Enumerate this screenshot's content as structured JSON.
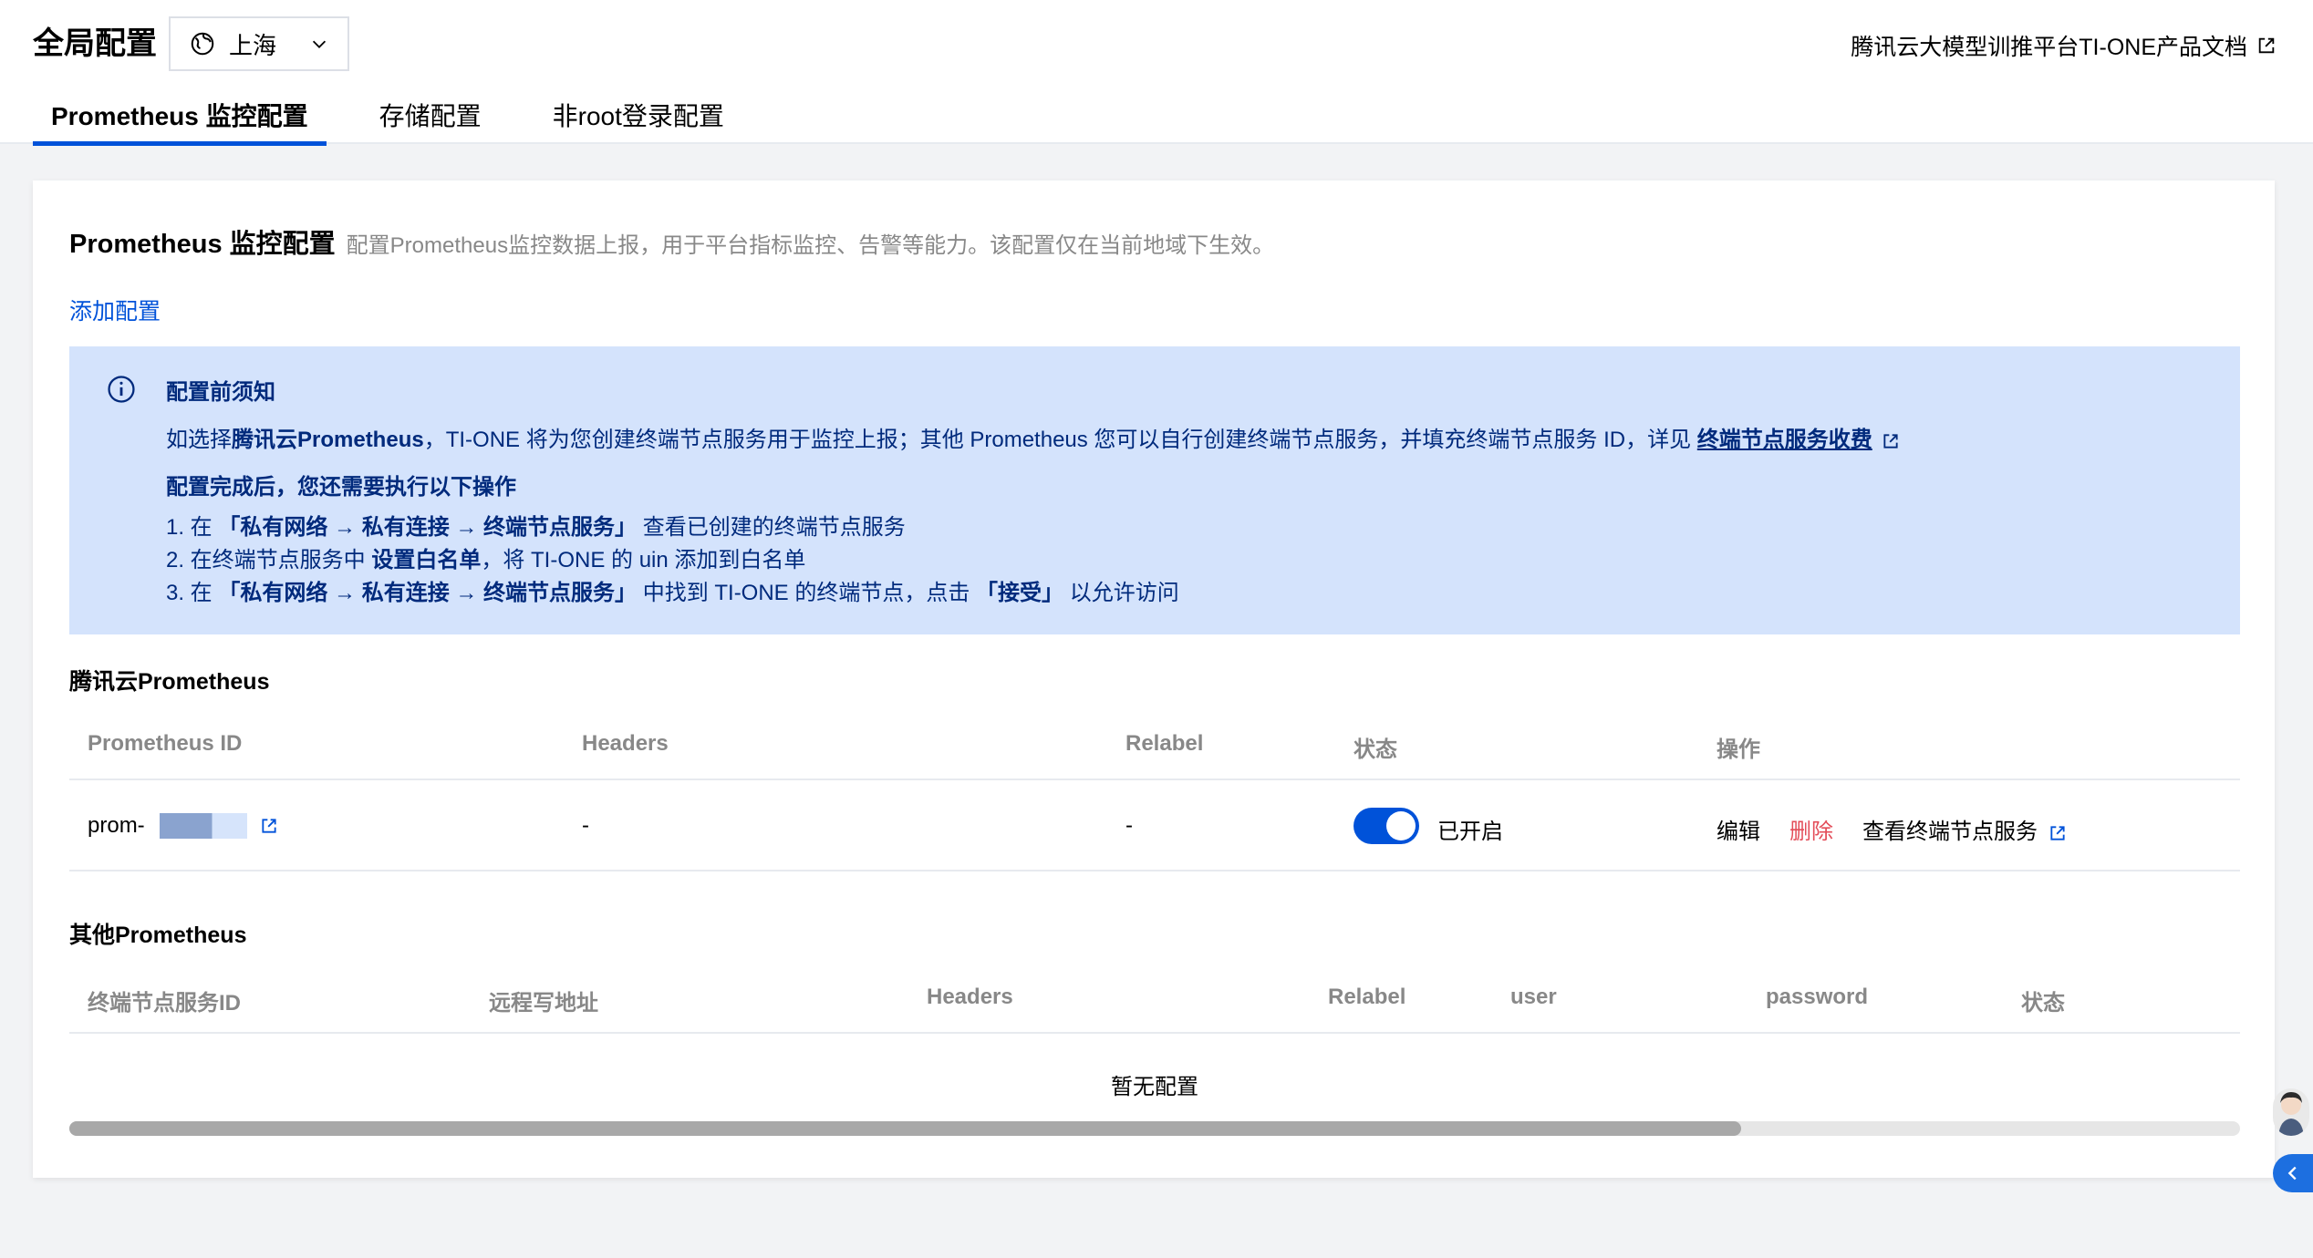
{
  "header": {
    "title": "全局配置",
    "region": "上海",
    "doc_link": "腾讯云大模型训推平台TI-ONE产品文档"
  },
  "tabs": [
    {
      "label": "Prometheus 监控配置",
      "active": true
    },
    {
      "label": "存储配置",
      "active": false
    },
    {
      "label": "非root登录配置",
      "active": false
    }
  ],
  "card": {
    "title": "Prometheus 监控配置",
    "description": "配置Prometheus监控数据上报，用于平台指标监控、告警等能力。该配置仅在当前地域下生效。",
    "add_link": "添加配置"
  },
  "notice": {
    "title": "配置前须知",
    "line1_prefix": "如选择",
    "line1_bold": "腾讯云Prometheus",
    "line1_middle": "，TI-ONE 将为您创建终端节点服务用于监控上报；其他 Prometheus 您可以自行创建终端节点服务，并填充终端节点服务 ID，详见 ",
    "line1_link": "终端节点服务收费",
    "subtitle": "配置完成后，您还需要执行以下操作",
    "step1_prefix": "1. 在 ",
    "step1_bold": "「私有网络 → 私有连接 → 终端节点服务」",
    "step1_suffix": " 查看已创建的终端节点服务",
    "step2_prefix": "2. 在终端节点服务中 ",
    "step2_bold": "设置白名单",
    "step2_suffix": "，将 TI-ONE 的 uin 添加到白名单",
    "step3_prefix": "3. 在 ",
    "step3_bold": "「私有网络 → 私有连接 → 终端节点服务」",
    "step3_middle": " 中找到 TI-ONE 的终端节点，点击 ",
    "step3_bold2": "「接受」",
    "step3_suffix": " 以允许访问"
  },
  "tencent_section": {
    "title": "腾讯云Prometheus",
    "columns": [
      "Prometheus ID",
      "Headers",
      "Relabel",
      "状态",
      "操作"
    ],
    "row": {
      "id_prefix": "prom-",
      "headers": "-",
      "relabel": "-",
      "status_enabled": true,
      "status_text": "已开启",
      "actions": [
        "编辑",
        "删除",
        "查看终端节点服务"
      ]
    }
  },
  "other_section": {
    "title": "其他Prometheus",
    "columns": [
      "终端节点服务ID",
      "远程写地址",
      "Headers",
      "Relabel",
      "user",
      "password",
      "状态"
    ],
    "empty_text": "暂无配置",
    "scroll_position": 0.77
  },
  "colors": {
    "accent": "#0052d9",
    "danger": "#e34d59",
    "notice_bg": "#d4e3fc",
    "notice_text": "#002a7c"
  }
}
